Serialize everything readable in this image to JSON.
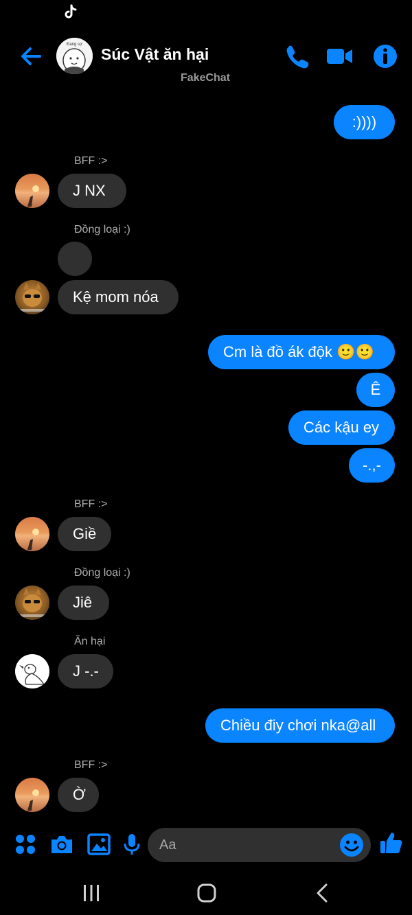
{
  "header": {
    "title": "Súc Vật ăn hại",
    "subtitle": "FakeChat",
    "group_avatar_text": "Đang sợ"
  },
  "messages": [
    {
      "dir": "out",
      "text": ":))))"
    },
    {
      "dir": "in",
      "sender": "BFF :>",
      "text": "J NX"
    },
    {
      "dir": "in",
      "sender": "Đồng loại :)",
      "text": ""
    },
    {
      "dir": "in",
      "text": "Kệ mom nóa"
    },
    {
      "dir": "out",
      "text": "Cm là đồ ák độk 🙂🙂"
    },
    {
      "dir": "out",
      "text": "Ê"
    },
    {
      "dir": "out",
      "text": "Các kậu ey"
    },
    {
      "dir": "out",
      "text": "-.,-"
    },
    {
      "dir": "in",
      "sender": "BFF :>",
      "text": "Giề"
    },
    {
      "dir": "in",
      "sender": "Đồng loại :)",
      "text": "Jiê"
    },
    {
      "dir": "in",
      "sender": "Ăn hại",
      "text": "J -.-"
    },
    {
      "dir": "out",
      "text": "Chiều điy chơi nka@all"
    },
    {
      "dir": "in",
      "sender": "BFF :>",
      "text": "Ờ"
    }
  ],
  "composer": {
    "placeholder": "Aa"
  },
  "colors": {
    "accent": "#0a84ff",
    "incoming_bubble": "#303030",
    "background": "#000000"
  },
  "icons": [
    "tiktok-icon",
    "back-arrow-icon",
    "phone-icon",
    "video-icon",
    "info-icon",
    "apps-icon",
    "camera-icon",
    "gallery-icon",
    "mic-icon",
    "emoji-icon",
    "thumbs-up-icon",
    "recents-nav-icon",
    "home-nav-icon",
    "back-nav-icon"
  ]
}
